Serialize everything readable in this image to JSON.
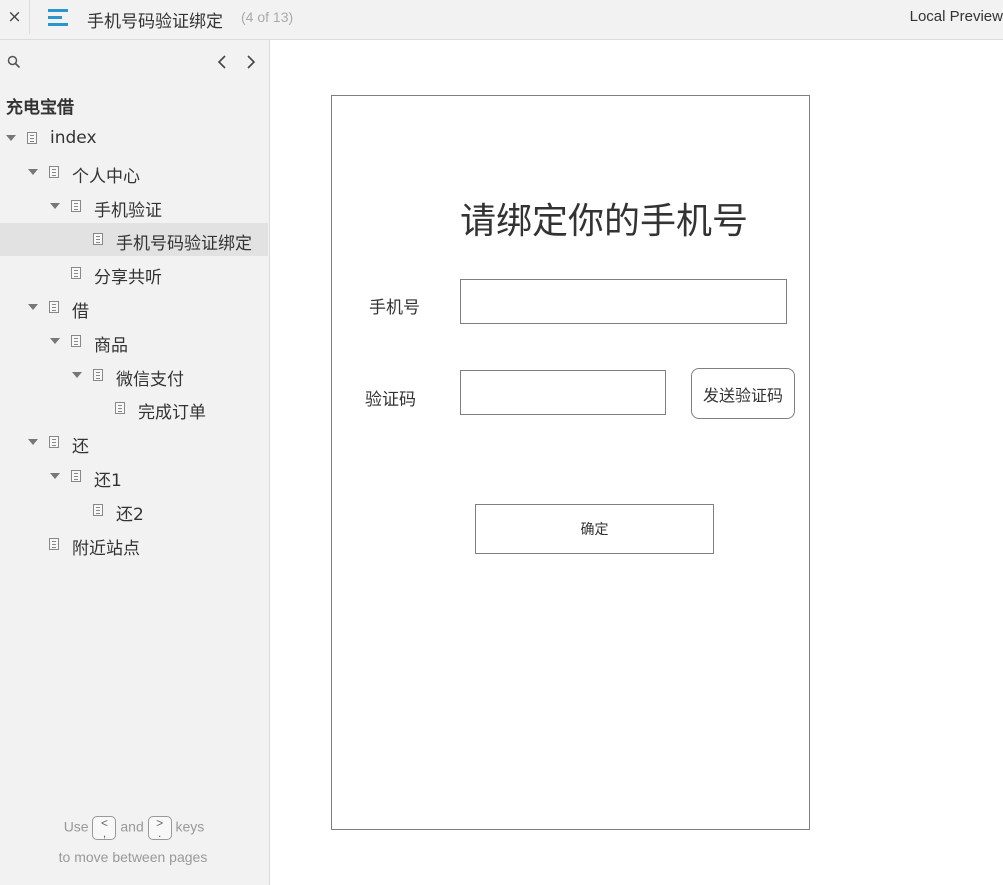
{
  "topbar": {
    "close_glyph": "×",
    "menu_icon": "hamburger-menu-icon",
    "menu_icon_color": "#2a96d0",
    "page_title": "手机号码验证绑定",
    "page_count": "(4 of 13)",
    "right_label": "Local Preview"
  },
  "sidebar": {
    "search_icon": "search-icon",
    "prev_icon": "chevron-left-icon",
    "next_icon": "chevron-right-icon",
    "project_name": "充电宝借",
    "tree": [
      {
        "label": "index",
        "level": 0,
        "expanded": true,
        "selected": false
      },
      {
        "label": "个人中心",
        "level": 1,
        "expanded": true,
        "selected": false
      },
      {
        "label": "手机验证",
        "level": 2,
        "expanded": true,
        "selected": false
      },
      {
        "label": "手机号码验证绑定",
        "level": 3,
        "expanded": false,
        "selected": true
      },
      {
        "label": "分享共听",
        "level": 2,
        "expanded": false,
        "selected": false
      },
      {
        "label": "借",
        "level": 1,
        "expanded": true,
        "selected": false
      },
      {
        "label": "商品",
        "level": 2,
        "expanded": true,
        "selected": false
      },
      {
        "label": "微信支付",
        "level": 3,
        "expanded": true,
        "selected": false
      },
      {
        "label": "完成订单",
        "level": 4,
        "expanded": false,
        "selected": false
      },
      {
        "label": "还",
        "level": 1,
        "expanded": true,
        "selected": false
      },
      {
        "label": "还1",
        "level": 2,
        "expanded": true,
        "selected": false
      },
      {
        "label": "还2",
        "level": 3,
        "expanded": false,
        "selected": false
      },
      {
        "label": "附近站点",
        "level": 1,
        "expanded": false,
        "selected": false
      }
    ],
    "hint": {
      "use": "Use",
      "key_prev_top": "<",
      "key_prev_bottom": ",",
      "and": "and",
      "key_next_top": ">",
      "key_next_bottom": ".",
      "keys": "keys",
      "line2": "to move between pages"
    }
  },
  "prototype": {
    "heading": "请绑定你的手机号",
    "phone_label": "手机号",
    "phone_value": "",
    "code_label": "验证码",
    "code_value": "",
    "send_code_label": "发送验证码",
    "confirm_label": "确定"
  }
}
